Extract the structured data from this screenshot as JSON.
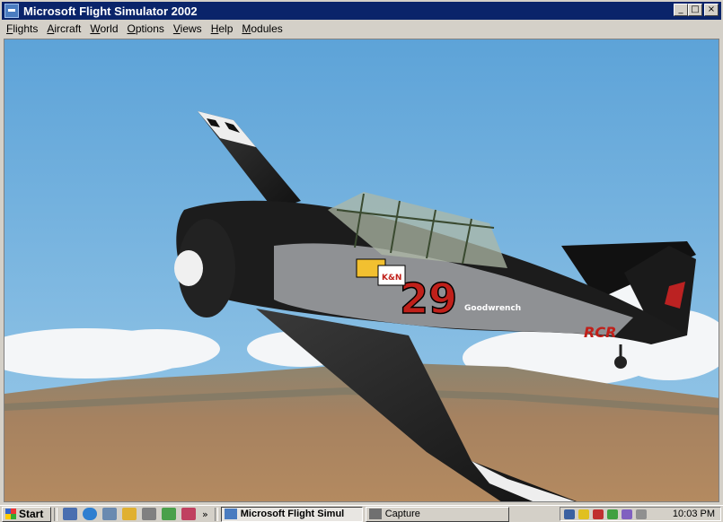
{
  "window": {
    "title": "Microsoft Flight Simulator 2002",
    "buttons": {
      "minimize": "_",
      "maximize": "□",
      "close": "×"
    }
  },
  "menu": [
    {
      "label": "Flights",
      "underline": "F",
      "rest": "lights"
    },
    {
      "label": "Aircraft",
      "underline": "A",
      "rest": "ircraft"
    },
    {
      "label": "World",
      "underline": "W",
      "rest": "orld"
    },
    {
      "label": "Options",
      "underline": "O",
      "rest": "ptions"
    },
    {
      "label": "Views",
      "underline": "V",
      "rest": "iews"
    },
    {
      "label": "Help",
      "underline": "H",
      "rest": "elp"
    },
    {
      "label": "Modules",
      "underline": "M",
      "rest": "odules"
    }
  ],
  "scene": {
    "aircraft_number": "29",
    "decals": [
      "K&N",
      "Goodwrench",
      "RCR"
    ],
    "sky_color": "#6fb0dc",
    "ground_color": "#a8825a"
  },
  "taskbar": {
    "start_label": "Start",
    "chevron": "»",
    "tasks": [
      {
        "label": "Microsoft Flight Simul",
        "active": true
      },
      {
        "label": "Capture",
        "active": false
      }
    ],
    "clock": "10:03 PM"
  }
}
